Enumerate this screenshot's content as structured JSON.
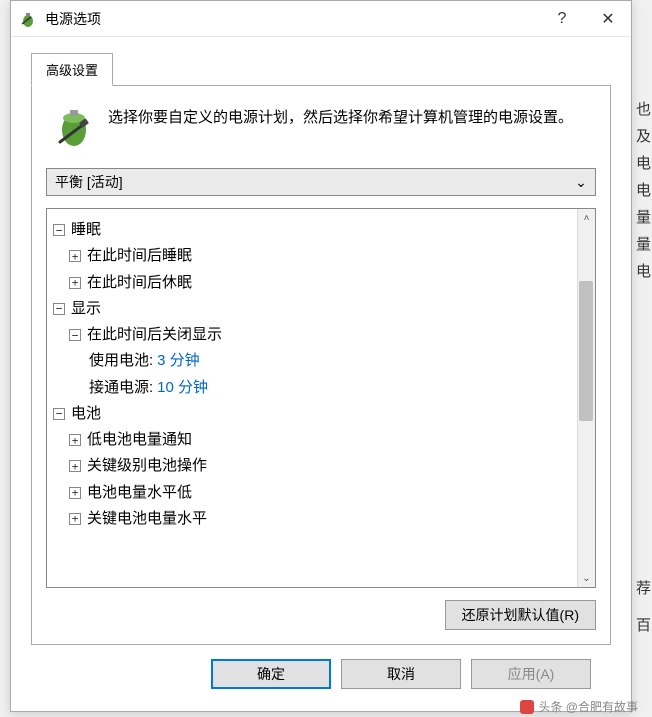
{
  "window": {
    "title": "电源选项"
  },
  "tab": {
    "label": "高级设置"
  },
  "description": "选择你要自定义的电源计划，然后选择你希望计算机管理的电源设置。",
  "planSelect": {
    "value": "平衡 [活动]"
  },
  "tree": {
    "sleep": {
      "label": "睡眠",
      "afterSleep": "在此时间后睡眠",
      "afterHibernate": "在此时间后休眠"
    },
    "display": {
      "label": "显示",
      "turnOff": {
        "label": "在此时间后关闭显示",
        "battery": {
          "label": "使用电池:",
          "value": "3 分钟"
        },
        "plugged": {
          "label": "接通电源:",
          "value": "10 分钟"
        }
      }
    },
    "battery": {
      "label": "电池",
      "lowNotify": "低电池电量通知",
      "critAction": "关键级别电池操作",
      "lowLevel": "电池电量水平低",
      "critLevel": "关键电池电量水平"
    }
  },
  "buttons": {
    "restore": "还原计划默认值(R)",
    "ok": "确定",
    "cancel": "取消",
    "apply": "应用(A)"
  },
  "watermark": "头条 @合肥有故事",
  "sideChars": [
    "也",
    "及",
    "电",
    "电",
    "量",
    "量",
    "电",
    "荐",
    "百"
  ],
  "glyphs": {
    "plus": "+",
    "minus": "−",
    "help": "?",
    "close": "✕",
    "down": "⌄",
    "up": "˄"
  }
}
